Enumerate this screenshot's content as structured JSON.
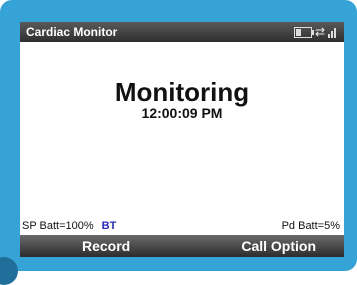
{
  "window": {
    "title": "Cardiac Monitor"
  },
  "status_icons": [
    "battery-icon",
    "connection-icon",
    "signal-icon"
  ],
  "main": {
    "heading": "Monitoring",
    "time": "12:00:09 PM"
  },
  "status_row": {
    "sp_battery": "SP Batt=100%",
    "bt": "BT",
    "pd_battery": "Pd Batt=5%"
  },
  "softkeys": {
    "left": "Record",
    "right": "Call Option"
  },
  "colors": {
    "frame": "#35a3d6",
    "bar": "#3a3a3a",
    "bt": "#2a2ab8"
  }
}
